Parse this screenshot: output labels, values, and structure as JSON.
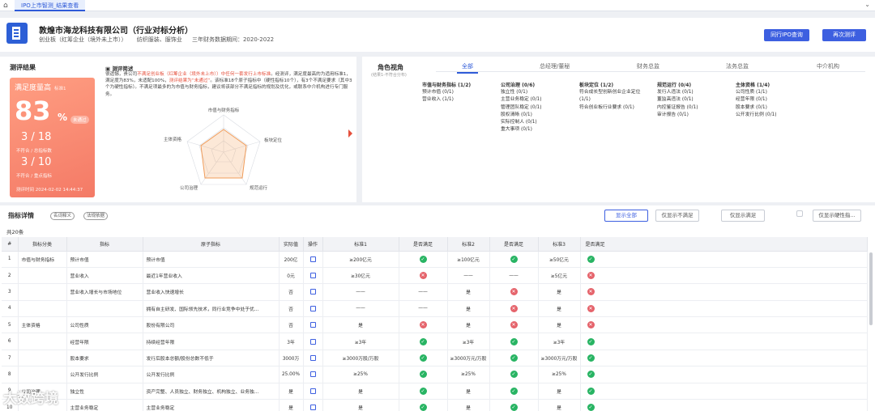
{
  "tabbar": {
    "tab_label": "IPO上市智测_结果查看"
  },
  "header": {
    "company": "敦煌市海龙科技有限公司（行业对标分析）",
    "board": "创业板（红筹企业（境外未上市））",
    "industry": "纺织服装、服饰业",
    "period": "三年财务数据期间：2020-2022",
    "btn_query": "同行IPO查询",
    "btn_retest": "再次测评"
  },
  "result": {
    "section_title": "测评结果",
    "score_label": "满足度量高",
    "score_small": "标准1",
    "score_value": "83",
    "score_unit": "%",
    "score_badge": "未通过",
    "frac1": "3 / 18",
    "frac1_label": "不符合 / 总指标数",
    "frac2": "3 / 10",
    "frac2_label": "不符合 / 重点指标",
    "time": "测评时间 2024-02-02 14:44:37",
    "desc_title": "测评简述",
    "desc_prefix": "很遗憾，贵公司",
    "desc_hl1": "不满足创业板（红筹企业（境外未上市））中任何一套发行上市标准",
    "desc_mid1": "。经测评，满足度最高的为适用标准1，满足度为83%，未适配100%，",
    "desc_hl2": "测评结果为“未通过”",
    "desc_suffix": "。该标准18个原子指标中（硬性指标10个），有3个不满足要求（其中3个为硬性指标）。不满足项最多的为市值与财务指标，建议将该部分不满足指标的规划及优化，或联系中介机构进行专门服务。",
    "radar_labels": [
      "市值与财务指标",
      "板块定位",
      "规范运行",
      "公司治理",
      "主体资格"
    ]
  },
  "roles": {
    "title": "角色视角",
    "subtitle": "(结果1-不符合分布)",
    "tabs": [
      "全部",
      "总经理/董秘",
      "财务总监",
      "法务总监",
      "中介机构"
    ],
    "columns": [
      {
        "head": "市值与财务指标 (1/2)",
        "red": false,
        "items": [
          "预计市值 (0/1)",
          "营业收入 (1/1)"
        ]
      },
      {
        "head": "公司治理 (0/6)",
        "red": false,
        "items": [
          "独立性 (0/1)",
          "主营业务稳定 (0/1)",
          "管理团队稳定 (0/1)",
          "股权清晰 (0/1)",
          "实际控制人 (0/1)",
          "重大事项 (0/1)"
        ]
      },
      {
        "head": "板块定位 (1/2)",
        "red": false,
        "items": [
          "符合成长型创新创业企业定位 (1/1)",
          "符合创业板行业要求 (0/1)"
        ]
      },
      {
        "head": "规范运行 (0/4)",
        "red": false,
        "items": [
          "发行人违法 (0/1)",
          "董监高违法 (0/1)",
          "内控鉴证报告 (0/1)",
          "审计报告 (0/1)"
        ]
      },
      {
        "head": "主体资格 (1/4)",
        "red": false,
        "items": [
          "公司性质 (1/1)",
          "经营年限 (0/1)",
          "股本要求 (0/1)",
          "公开发行比例 (0/1)"
        ]
      }
    ]
  },
  "detail": {
    "title": "指标详情",
    "chip1": "名词释义",
    "chip2": "法规依据",
    "count": "共20条",
    "btn_all": "显示全部",
    "btn_unmet": "仅显示不满足",
    "btn_met": "仅显示满足",
    "btn_hard": "仅显示硬性指...",
    "headers": [
      "#",
      "指标分类",
      "指标",
      "原子指标",
      "实际值",
      "操作",
      "标准1",
      "是否满足",
      "标准2",
      "是否满足",
      "标准3",
      "是否满足"
    ],
    "rows": [
      [
        "1",
        "市值与财务指标",
        "预计市值",
        "预计市值",
        "200亿",
        "e",
        "≥200亿元",
        "ok",
        "≥100亿元",
        "ok",
        "≥50亿元",
        "ok"
      ],
      [
        "2",
        "",
        "营业收入",
        "最近1年营业收入",
        "0元",
        "e",
        "≥30亿元",
        "no",
        "——",
        "——",
        "≥5亿元",
        "no"
      ],
      [
        "3",
        "",
        "营业收入增长与市场地位",
        "营业收入快速增长",
        "否",
        "e",
        "——",
        "——",
        "是",
        "no",
        "是",
        "no"
      ],
      [
        "4",
        "",
        "",
        "拥有自主研发、国际领先技术，同行业竞争中处于优...",
        "否",
        "e",
        "——",
        "——",
        "是",
        "no",
        "是",
        "no"
      ],
      [
        "5",
        "主体资格",
        "公司性质",
        "股份有限公司",
        "否",
        "e",
        "是",
        "no",
        "是",
        "no",
        "是",
        "no"
      ],
      [
        "6",
        "",
        "经营年限",
        "持续经营年限",
        "3年",
        "e",
        "≥3年",
        "ok",
        "≥3年",
        "ok",
        "≥3年",
        "ok"
      ],
      [
        "7",
        "",
        "股本要求",
        "发行后股本总额/股份总数不低于",
        "3000万",
        "e",
        "≥3000万股/万股",
        "ok",
        "≥3000万元/万股",
        "ok",
        "≥3000万元/万股",
        "ok"
      ],
      [
        "8",
        "",
        "公开发行比例",
        "公开发行比例",
        "25.00%",
        "e",
        "≥25%",
        "ok",
        "≥25%",
        "ok",
        "≥25%",
        "ok"
      ],
      [
        "9",
        "公司治理",
        "独立性",
        "资产完整、人员独立、财务独立、机构独立、业务独...",
        "是",
        "e",
        "是",
        "ok",
        "是",
        "ok",
        "是",
        "ok"
      ],
      [
        "10",
        "",
        "主营业务稳定",
        "主营业务稳定",
        "是",
        "e",
        "是",
        "ok",
        "是",
        "ok",
        "是",
        "ok"
      ]
    ]
  },
  "watermark": "大数跨境"
}
